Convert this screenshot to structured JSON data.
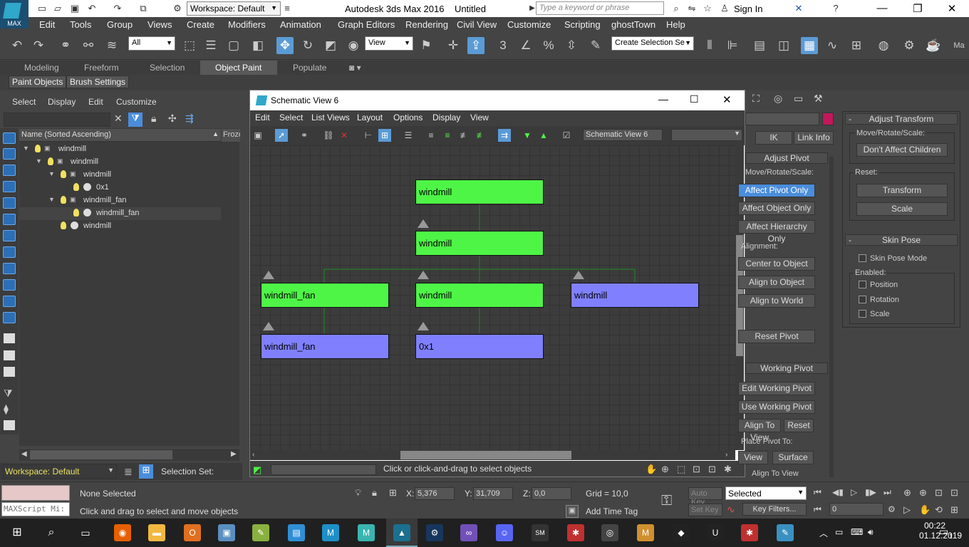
{
  "app": {
    "logo_text": "MAX",
    "workspace": "Workspace: Default",
    "title": "Autodesk 3ds Max 2016",
    "document": "Untitled",
    "search_placeholder": "Type a keyword or phrase",
    "sign_in": "Sign In"
  },
  "menu": [
    "Edit",
    "Tools",
    "Group",
    "Views",
    "Create",
    "Modifiers",
    "Animation",
    "Graph Editors",
    "Rendering",
    "Civil View",
    "Customize",
    "Scripting",
    "ghostTown",
    "Help"
  ],
  "toolbar": {
    "filter": "All",
    "view": "View",
    "selection_set": "Create Selection Se",
    "snap_label": "3"
  },
  "ribbon": {
    "tabs": [
      "Modeling",
      "Freeform",
      "Selection",
      "Object Paint",
      "Populate"
    ],
    "active_tab": "Object Paint",
    "buttons": [
      "Paint Objects",
      "Brush Settings"
    ]
  },
  "scene_explorer": {
    "menus": [
      "Select",
      "Display",
      "Edit",
      "Customize"
    ],
    "column": "Name (Sorted Ascending)",
    "column2": "Frozen",
    "rows": [
      {
        "name": "windmill"
      },
      {
        "name": "windmill"
      },
      {
        "name": "windmill"
      },
      {
        "name": "0x1"
      },
      {
        "name": "windmill_fan"
      },
      {
        "name": "windmill_fan"
      },
      {
        "name": "windmill"
      }
    ],
    "workspace": "Workspace: Default",
    "selection_set": "Selection Set:"
  },
  "schematic": {
    "title": "Schematic View 6",
    "menus": [
      "Edit",
      "Select",
      "List Views",
      "Layout",
      "Options",
      "Display",
      "View"
    ],
    "name_field": "Schematic View 6",
    "nodes": [
      {
        "label": "windmill"
      },
      {
        "label": "windmill"
      },
      {
        "label": "windmill_fan"
      },
      {
        "label": "windmill"
      },
      {
        "label": "windmill"
      },
      {
        "label": "windmill_fan"
      },
      {
        "label": "0x1"
      }
    ],
    "prompt": "Click or click-and-drag to select objects"
  },
  "command_panel": {
    "tabs": [
      "IK",
      "Link Info"
    ],
    "adjust_pivot": "Adjust Pivot",
    "move_rotate_scale": "Move/Rotate/Scale:",
    "affect_pivot_only": "Affect Pivot Only",
    "affect_object_only": "Affect Object Only",
    "affect_hierarchy_only": "Affect Hierarchy Only",
    "alignment": "Alignment:",
    "center_to_object": "Center to Object",
    "align_to_object": "Align to Object",
    "align_to_world": "Align to World",
    "reset_pivot": "Reset Pivot",
    "working_pivot": "Working Pivot",
    "edit_working_pivot": "Edit Working Pivot",
    "use_working_pivot": "Use Working Pivot",
    "align_to_view": "Align To View",
    "reset": "Reset",
    "place_pivot_to": "Place Pivot To:",
    "view": "View",
    "surface": "Surface",
    "align_to_view_chk": "Align To View",
    "adjust_transform": "Adjust Transform",
    "move_rotate_scale2": "Move/Rotate/Scale:",
    "dont_affect_children": "Don't Affect Children",
    "reset_label": "Reset:",
    "transform": "Transform",
    "scale_btn": "Scale",
    "skin_pose": "Skin Pose",
    "skin_pose_mode": "Skin Pose Mode",
    "enabled": "Enabled:",
    "position": "Position",
    "rotation": "Rotation",
    "scale": "Scale",
    "accent": "#c2185b"
  },
  "status": {
    "maxscript": "MAXScript Mi:",
    "selection": "None Selected",
    "hint": "Click and drag to select and move objects",
    "x_label": "X:",
    "x": "5,376",
    "y_label": "Y:",
    "y": "31,709",
    "z_label": "Z:",
    "z": "0,0",
    "grid": "Grid = 10,0",
    "add_time_tag": "Add Time Tag",
    "auto_key": "Auto Key",
    "set_key": "Set Key",
    "selected": "Selected",
    "key_filters": "Key Filters...",
    "frame": "0"
  },
  "taskbar": {
    "time": "00:22",
    "date": "01.12.2019",
    "notifications": "1"
  }
}
